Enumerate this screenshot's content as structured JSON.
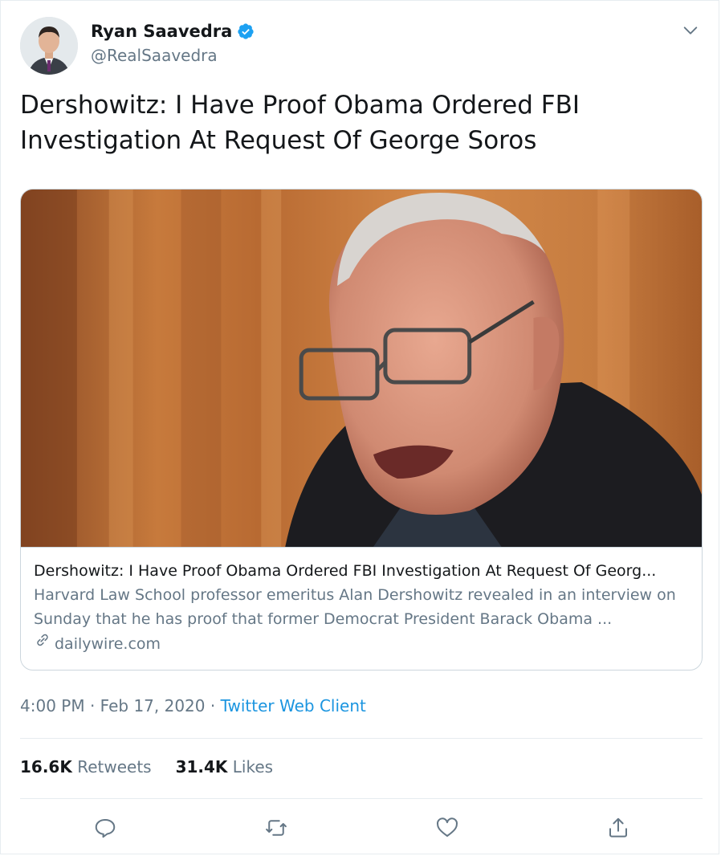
{
  "author": {
    "name": "Ryan Saavedra",
    "handle": "@RealSaavedra",
    "verified": true
  },
  "tweet": {
    "text": "Dershowitz: I Have Proof Obama Ordered FBI Investigation At Request Of George Soros"
  },
  "card": {
    "title": "Dershowitz: I Have Proof Obama Ordered FBI Investigation At Request Of Georg...",
    "description": "Harvard Law School professor emeritus Alan Dershowitz revealed in an interview on Sunday that he has proof that former Democrat President Barack Obama ...",
    "domain": "dailywire.com"
  },
  "meta": {
    "time": "4:00 PM",
    "separator": "·",
    "date": "Feb 17, 2020",
    "source": "Twitter Web Client"
  },
  "stats": {
    "retweets_count": "16.6K",
    "retweets_label": "Retweets",
    "likes_count": "31.4K",
    "likes_label": "Likes"
  },
  "icons": {
    "reply": "reply-icon",
    "retweet": "retweet-icon",
    "like": "heart-icon",
    "share": "share-icon",
    "verified": "verified-badge-icon",
    "caret": "chevron-down-icon",
    "link": "link-icon"
  },
  "colors": {
    "link": "#1b95e0",
    "secondary_text": "#657786",
    "verified": "#1da1f2",
    "border": "#e6ecf0"
  }
}
